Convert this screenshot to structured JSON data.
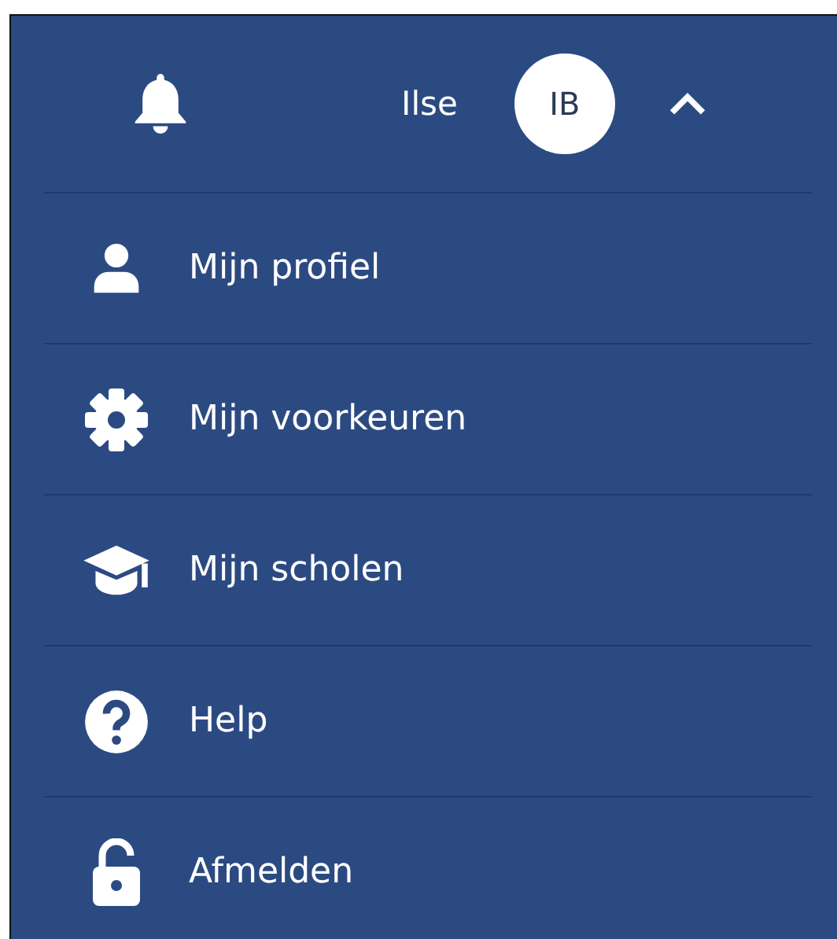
{
  "header": {
    "user_name": "Ilse",
    "avatar_initials": "IB",
    "expanded": true
  },
  "menu_items": [
    {
      "label": "Mijn profiel"
    },
    {
      "label": "Mijn voorkeuren"
    },
    {
      "label": "Mijn scholen"
    },
    {
      "label": "Help"
    },
    {
      "label": "Afmelden"
    }
  ]
}
